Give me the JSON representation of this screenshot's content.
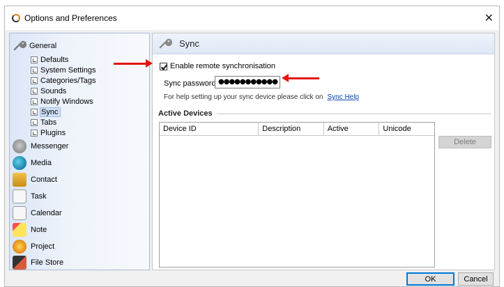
{
  "window": {
    "title": "Options and Preferences",
    "close_glyph": "✕"
  },
  "sidebar": {
    "general": {
      "label": "General",
      "icon": "wrench-icon"
    },
    "general_items": [
      {
        "label": "Defaults"
      },
      {
        "label": "System Settings"
      },
      {
        "label": "Categories/Tags"
      },
      {
        "label": "Sounds"
      },
      {
        "label": "Notify Windows"
      },
      {
        "label": "Sync",
        "selected": true
      },
      {
        "label": "Tabs"
      },
      {
        "label": "Plugins"
      }
    ],
    "sections": [
      {
        "label": "Messenger",
        "icon": "messenger-icon"
      },
      {
        "label": "Media",
        "icon": "media-icon"
      },
      {
        "label": "Contact",
        "icon": "contact-icon"
      },
      {
        "label": "Task",
        "icon": "task-icon"
      },
      {
        "label": "Calendar",
        "icon": "calendar-icon"
      },
      {
        "label": "Note",
        "icon": "note-icon"
      },
      {
        "label": "Project",
        "icon": "project-icon"
      },
      {
        "label": "File Store",
        "icon": "file-store-icon"
      }
    ]
  },
  "panel": {
    "title": "Sync",
    "enable_sync": {
      "label": "Enable remote synchronisation",
      "checked": true
    },
    "password": {
      "label": "Sync password:",
      "value": "●●●●●●●●●●●"
    },
    "help": {
      "text": "For help setting up your sync device please click on",
      "link": "Sync Help"
    },
    "devices": {
      "title": "Active Devices",
      "columns": [
        "Device ID",
        "Description",
        "Active",
        "Unicode"
      ],
      "rows": []
    },
    "delete_label": "Delete"
  },
  "footer": {
    "ok_label": "OK",
    "cancel_label": "Cancel"
  },
  "colors": {
    "accent": "#0078d7",
    "annotation": "#e3140f",
    "sidebar_tint": "#dbe6f7"
  }
}
